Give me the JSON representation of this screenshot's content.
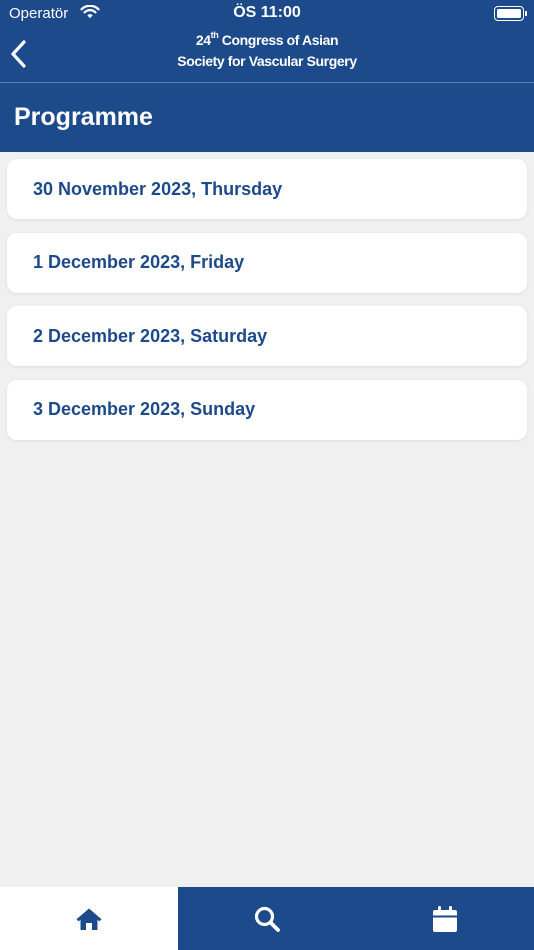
{
  "status_bar": {
    "carrier": "Operatör",
    "time": "ÖS 11:00",
    "icons": [
      "wifi-icon",
      "battery-icon"
    ]
  },
  "header": {
    "back_icon": "chevron-left-icon",
    "congress_line1_number": "24",
    "congress_line1_suffix": "th",
    "congress_line1_rest": " Congress of Asian",
    "congress_line2": "Society for Vascular Surgery"
  },
  "page": {
    "title": "Programme"
  },
  "days": [
    {
      "label": "30 November 2023, Thursday"
    },
    {
      "label": "1 December 2023, Friday"
    },
    {
      "label": "2 December 2023, Saturday"
    },
    {
      "label": "3 December 2023, Sunday"
    }
  ],
  "tabbar": {
    "tabs": [
      {
        "icon": "home-icon",
        "active": true
      },
      {
        "icon": "search-icon",
        "active": false
      },
      {
        "icon": "calendar-icon",
        "active": false
      }
    ]
  },
  "colors": {
    "brand": "#1c4a8a",
    "background": "#f0f0f0",
    "card": "#ffffff"
  }
}
